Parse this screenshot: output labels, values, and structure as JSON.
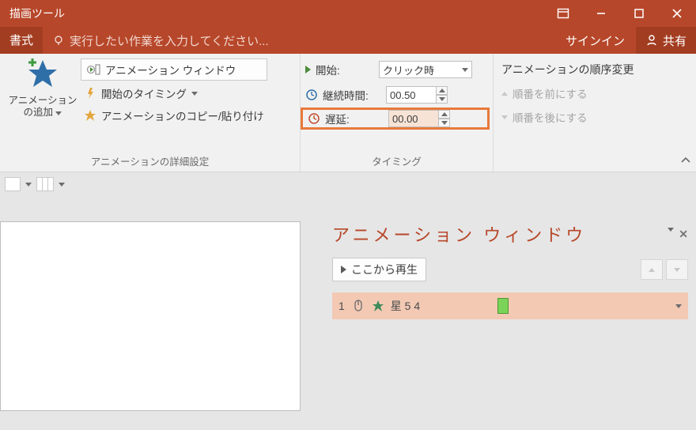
{
  "title_tools": "描画ツール",
  "tabs": {
    "format": "書式"
  },
  "tellme_placeholder": "実行したい作業を入力してください...",
  "signin": "サインイン",
  "share": "共有",
  "ribbon": {
    "add_animation": {
      "line1": "アニメーション",
      "line2": "の追加"
    },
    "group1_label": "アニメーションの詳細設定",
    "anim_pane_btn": "アニメーション ウィンドウ",
    "trigger_btn": "開始のタイミング",
    "copy_paste_btn": "アニメーションのコピー/貼り付け",
    "start_label": "開始:",
    "start_value": "クリック時",
    "duration_label": "継続時間:",
    "duration_value": "00.50",
    "delay_label": "遅延:",
    "delay_value": "00.00",
    "timing_group_label": "タイミング",
    "reorder_title": "アニメーションの順序変更",
    "move_earlier": "順番を前にする",
    "move_later": "順番を後にする"
  },
  "panel": {
    "title": "アニメーション ウィンドウ",
    "play_btn": "ここから再生",
    "item_index": "1",
    "item_label": "星 5 4"
  }
}
